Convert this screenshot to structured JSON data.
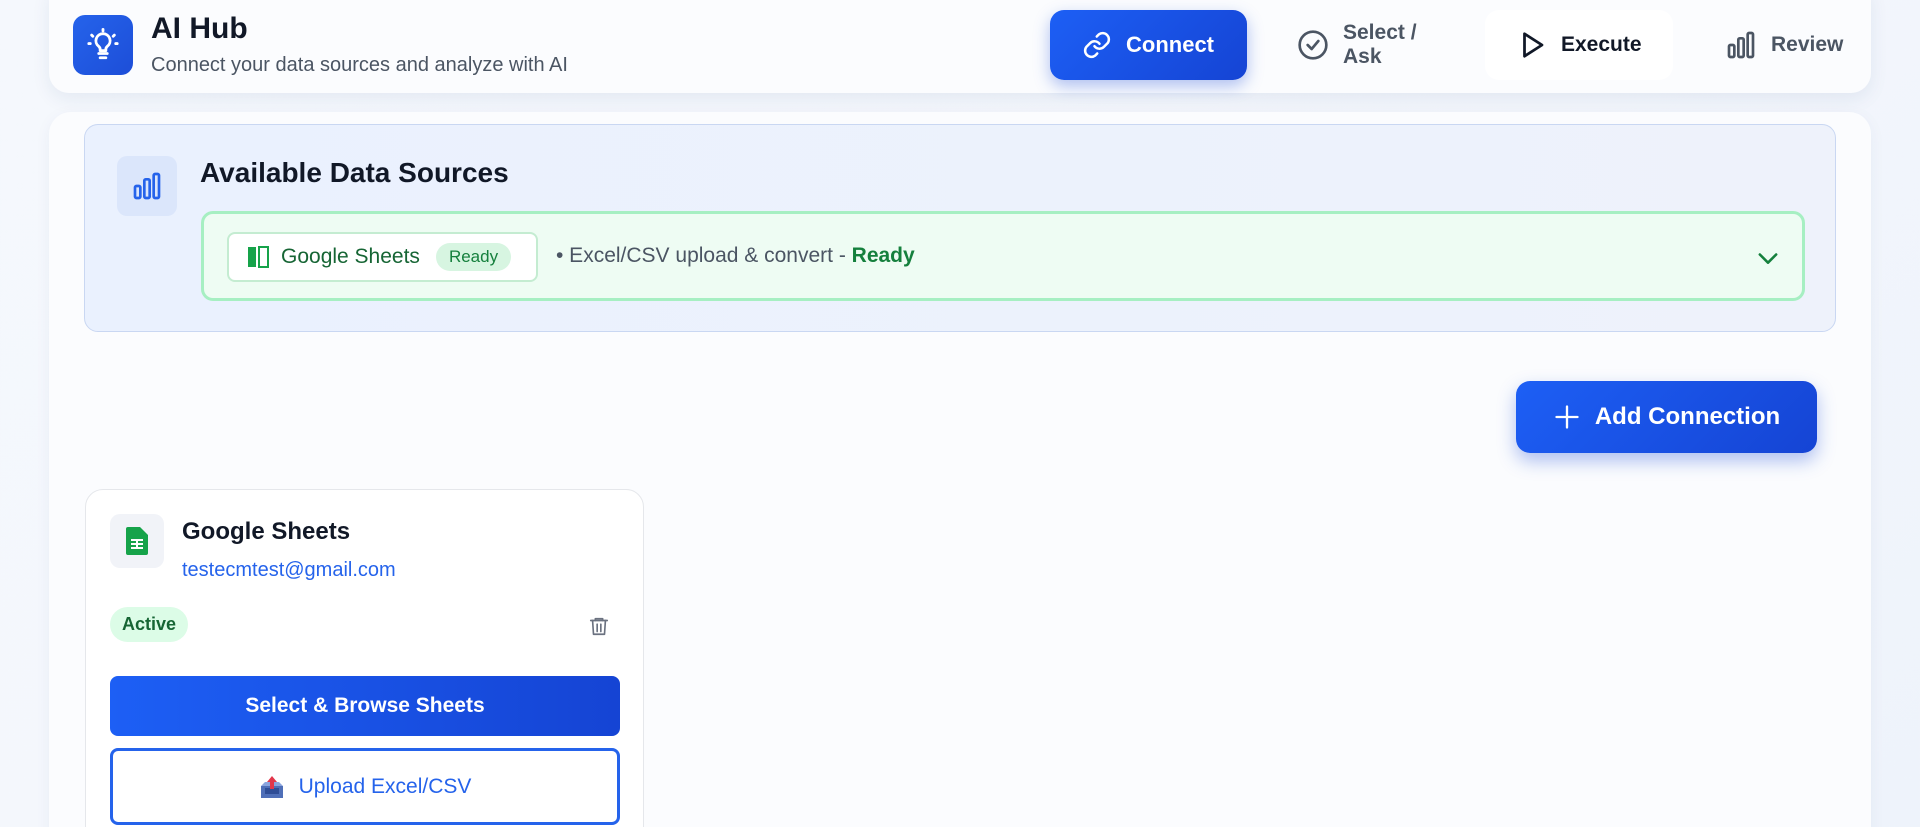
{
  "header": {
    "logo_icon": "lightbulb-icon",
    "title": "AI Hub",
    "subtitle": "Connect your data sources and analyze with AI",
    "steps": [
      {
        "label": "Connect",
        "icon": "link-icon",
        "state": "active"
      },
      {
        "label": "Select / Ask",
        "icon": "check-circle-icon",
        "state": "inactive"
      },
      {
        "label": "Execute",
        "icon": "play-icon",
        "state": "inactive"
      },
      {
        "label": "Review",
        "icon": "bar-chart-icon",
        "state": "inactive"
      }
    ]
  },
  "sources": {
    "icon": "bar-chart-icon",
    "title": "Available Data Sources",
    "items": [
      {
        "name": "Google Sheets",
        "icon": "sheets-columns-icon",
        "badge": "Ready",
        "description_prefix": "• Excel/CSV upload & convert - ",
        "description_status": "Ready"
      }
    ]
  },
  "add_connection": {
    "label": "Add Connection",
    "icon": "plus-icon"
  },
  "connections": [
    {
      "name": "Google Sheets",
      "icon": "google-sheets-icon",
      "email": "testecmtest@gmail.com",
      "status": "Active",
      "primary_action": "Select & Browse Sheets",
      "secondary_action": "Upload Excel/CSV",
      "secondary_icon": "upload-inbox-icon"
    }
  ],
  "colors": {
    "accent": "#1d5ff5",
    "accent_dark": "#1544d4",
    "success": "#15803d",
    "success_bg": "#eefcf3",
    "panel_bg": "#eaf1fe"
  }
}
